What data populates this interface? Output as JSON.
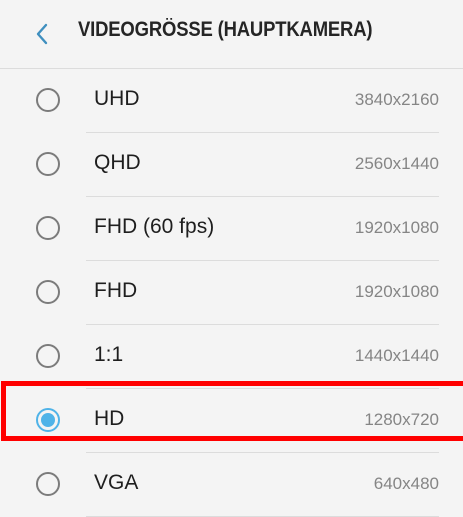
{
  "header": {
    "title": "VIDEOGRÖSSE (HAUPTKAMERA)",
    "back_icon": "chevron-left-icon"
  },
  "options": [
    {
      "label": "UHD",
      "resolution": "3840x2160",
      "selected": false
    },
    {
      "label": "QHD",
      "resolution": "2560x1440",
      "selected": false
    },
    {
      "label": "FHD (60 fps)",
      "resolution": "1920x1080",
      "selected": false
    },
    {
      "label": "FHD",
      "resolution": "1920x1080",
      "selected": false
    },
    {
      "label": "1:1",
      "resolution": "1440x1440",
      "selected": false
    },
    {
      "label": "HD",
      "resolution": "1280x720",
      "selected": true
    },
    {
      "label": "VGA",
      "resolution": "640x480",
      "selected": false
    }
  ],
  "colors": {
    "accent": "#4fb3e8",
    "highlight": "#ff0000",
    "background": "#f4f4f4"
  }
}
